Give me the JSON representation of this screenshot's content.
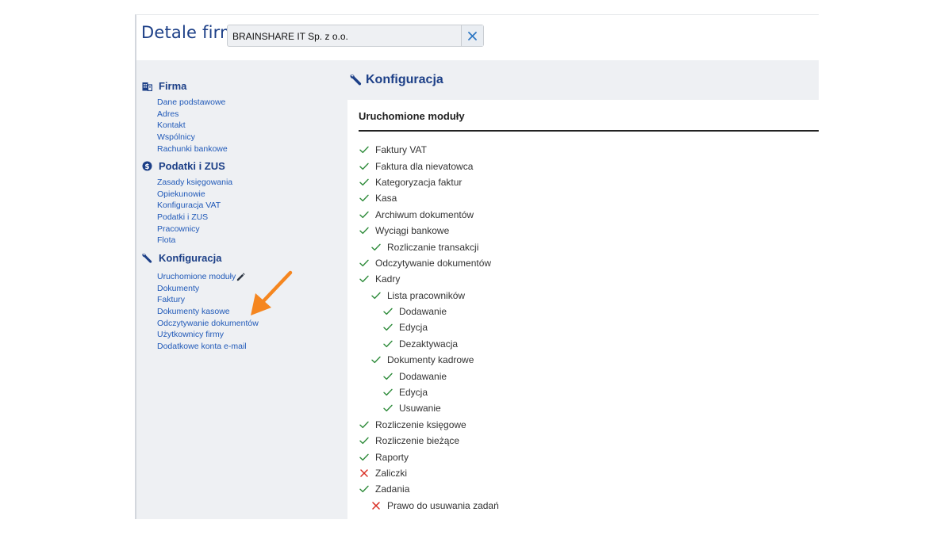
{
  "header": {
    "title": "Detale firmy",
    "company": "BRAINSHARE IT Sp. z o.o."
  },
  "colors": {
    "accent": "#1c3f87",
    "link": "#2059b8",
    "ok": "#2e8b3a",
    "off": "#d93025",
    "arrow": "#f5861f"
  },
  "sidebar": {
    "sections": [
      {
        "label": "Firma",
        "icon": "building-icon",
        "items": [
          "Dane podstawowe",
          "Adres",
          "Kontakt",
          "Wspólnicy",
          "Rachunki bankowe"
        ]
      },
      {
        "label": "Podatki i ZUS",
        "icon": "dollar-coin-icon",
        "items": [
          "Zasady księgowania",
          "Opiekunowie",
          "Konfiguracja VAT",
          "Podatki i ZUS",
          "Pracownicy",
          "Flota"
        ]
      },
      {
        "label": "Konfiguracja",
        "icon": "wrench-icon",
        "items": [
          "Uruchomione moduły",
          "Dokumenty",
          "Faktury",
          "Dokumenty kasowe",
          "Odczytywanie dokumentów",
          "Użytkownicy firmy",
          "Dodatkowe konta e-mail"
        ]
      }
    ]
  },
  "main": {
    "title": "Konfiguracja",
    "panel_title": "Uruchomione moduły",
    "modules": [
      {
        "label": "Faktury VAT",
        "level": 0,
        "enabled": true
      },
      {
        "label": "Faktura dla nievatowca",
        "level": 0,
        "enabled": true
      },
      {
        "label": "Kategoryzacja faktur",
        "level": 0,
        "enabled": true
      },
      {
        "label": "Kasa",
        "level": 0,
        "enabled": true
      },
      {
        "label": "Archiwum dokumentów",
        "level": 0,
        "enabled": true
      },
      {
        "label": "Wyciągi bankowe",
        "level": 0,
        "enabled": true
      },
      {
        "label": "Rozliczanie transakcji",
        "level": 1,
        "enabled": true
      },
      {
        "label": "Odczytywanie dokumentów",
        "level": 0,
        "enabled": true
      },
      {
        "label": "Kadry",
        "level": 0,
        "enabled": true
      },
      {
        "label": "Lista pracowników",
        "level": 1,
        "enabled": true
      },
      {
        "label": "Dodawanie",
        "level": 2,
        "enabled": true
      },
      {
        "label": "Edycja",
        "level": 2,
        "enabled": true
      },
      {
        "label": "Dezaktywacja",
        "level": 2,
        "enabled": true
      },
      {
        "label": "Dokumenty kadrowe",
        "level": 1,
        "enabled": true
      },
      {
        "label": "Dodawanie",
        "level": 2,
        "enabled": true
      },
      {
        "label": "Edycja",
        "level": 2,
        "enabled": true
      },
      {
        "label": "Usuwanie",
        "level": 2,
        "enabled": true
      },
      {
        "label": "Rozliczenie księgowe",
        "level": 0,
        "enabled": true
      },
      {
        "label": "Rozliczenie bieżące",
        "level": 0,
        "enabled": true
      },
      {
        "label": "Raporty",
        "level": 0,
        "enabled": true
      },
      {
        "label": "Zaliczki",
        "level": 0,
        "enabled": false
      },
      {
        "label": "Zadania",
        "level": 0,
        "enabled": true
      },
      {
        "label": "Prawo do usuwania zadań",
        "level": 1,
        "enabled": false
      }
    ]
  }
}
